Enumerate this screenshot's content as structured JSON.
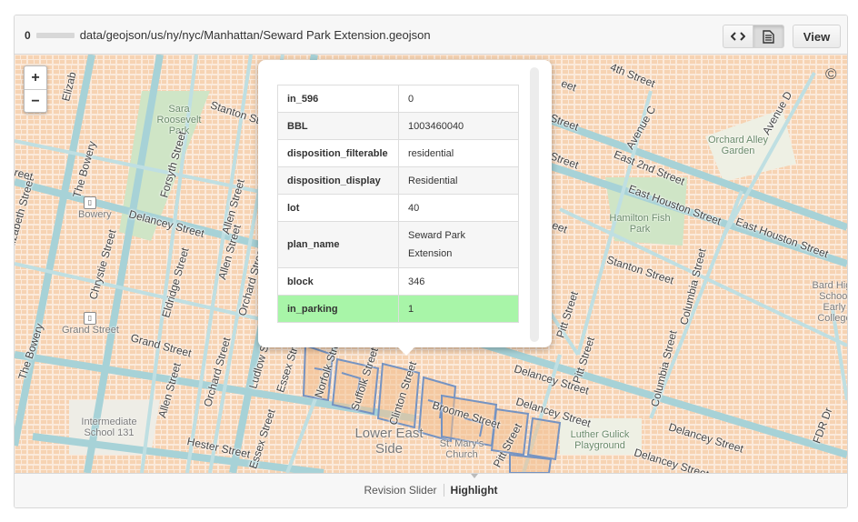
{
  "header": {
    "file_count": "0",
    "file_path": "data/geojson/us/ny/nyc/Manhattan/Seward Park Extension.geojson",
    "code_icon": "code-icon",
    "rendered_icon": "document-icon",
    "view_label": "View"
  },
  "map": {
    "zoom_in": "+",
    "zoom_out": "−",
    "attribution": "©",
    "labels": {
      "sara_roosevelt_park": "Sara Roosevelt Park",
      "bowery": "Bowery",
      "grand_street_station": "Grand Street",
      "intermediate_school": "Intermediate School 131",
      "lower_east_side": "Lower East Side",
      "st_marys_church": "St. Mary's Church",
      "luther_gulick": "Luther Gulick Playground",
      "hamilton_fish": "Hamilton Fish Park",
      "orchard_alley": "Orchard Alley Garden",
      "bard_high": "Bard High School Early College"
    },
    "streets": {
      "elizabeth": "Elizabeth Street",
      "the_bowery": "The Bowery",
      "the_bowery_2": "The Bowery",
      "delancey_left": "Delancey Street",
      "chrystie": "Chrystie Street",
      "forsyth": "Forsyth Street",
      "eldridge": "Eldridge Street",
      "allen": "Allen Street",
      "allen_2": "Allen Street",
      "allen_3": "Allen Street",
      "orchard": "Orchard Street",
      "orchard_2": "Orchard Street",
      "ludlow": "Ludlow Street",
      "grand": "Grand Street",
      "hester": "Hester Street",
      "essex": "Essex Street",
      "essex_2": "Essex Street",
      "norfolk": "Norfolk Street",
      "suffolk": "Suffolk Street",
      "clinton": "Clinton Street",
      "broome": "Broome Street",
      "pitt_bottom": "Pitt Street",
      "pitt": "Pitt Street",
      "pitt_2": "Pitt Street",
      "delancey_mid": "Delancey Street",
      "delancey_right": "Delancey Street",
      "delancey_right_2": "Delancey Street",
      "delancey_right_3": "Delancey Street",
      "stanton_left": "Stanton Street",
      "stanton_right": "Stanton Street",
      "fourth": "4th Street",
      "avenue_c": "Avenue C",
      "avenue_d": "Avenue D",
      "east_2nd": "East 2nd Street",
      "east_houston": "East Houston Street",
      "east_houston_2": "East Houston Street",
      "columbia": "Columbia Street",
      "columbia_2": "Columbia Street",
      "fdr": "FDR Dr",
      "street_a": "Street",
      "street_b": "Street",
      "street_c": "eet",
      "eet": "eet",
      "elizab": "Elizab",
      "reet": "reet"
    }
  },
  "popup": {
    "rows": [
      {
        "key": "in_596",
        "value": "0"
      },
      {
        "key": "BBL",
        "value": "1003460040"
      },
      {
        "key": "disposition_filterable",
        "value": "residential"
      },
      {
        "key": "disposition_display",
        "value": "Residential"
      },
      {
        "key": "lot",
        "value": "40"
      },
      {
        "key": "plan_name",
        "value": "Seward Park Extension"
      },
      {
        "key": "block",
        "value": "346"
      },
      {
        "key": "in_parking",
        "value": "1"
      }
    ]
  },
  "footer": {
    "revision_slider": "Revision Slider",
    "highlight": "Highlight"
  },
  "colors": {
    "highlight_row": "#a8f5a8",
    "building": "#f7d4b5",
    "road": "#a6d1d6",
    "park": "#c9e3c2",
    "geojson_stroke": "#7593c2"
  }
}
